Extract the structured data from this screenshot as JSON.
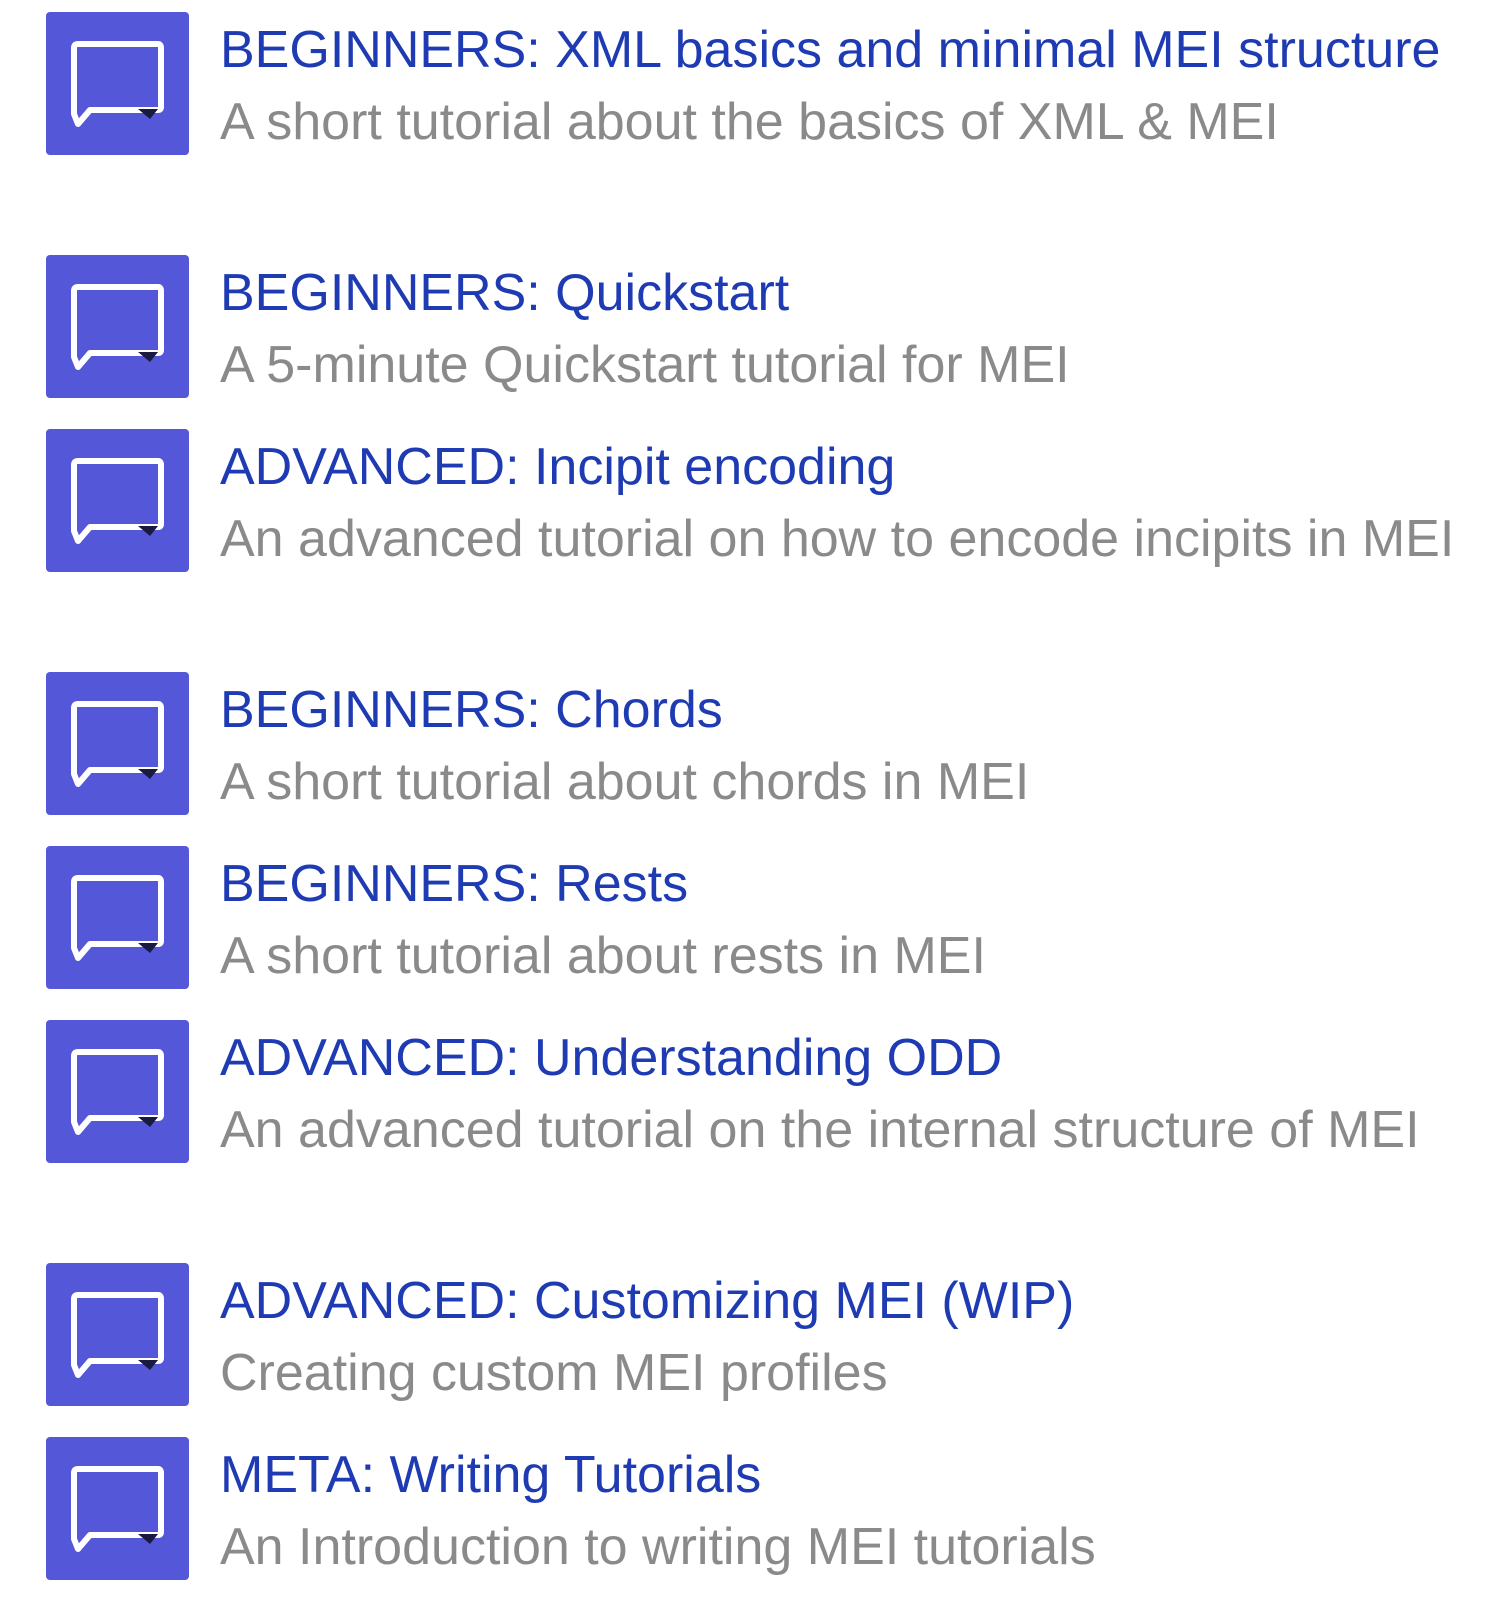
{
  "tutorials": [
    {
      "icon": "speech-bubble-icon",
      "title": "BEGINNERS: XML basics and minimal MEI structure",
      "description": "A short tutorial about the basics of XML & MEI"
    },
    {
      "icon": "speech-bubble-icon",
      "title": "BEGINNERS: Quickstart",
      "description": "A 5-minute Quickstart tutorial for MEI"
    },
    {
      "icon": "speech-bubble-icon",
      "title": "ADVANCED: Incipit encoding",
      "description": "An advanced tutorial on how to encode incipits in MEI"
    },
    {
      "icon": "speech-bubble-icon",
      "title": "BEGINNERS: Chords",
      "description": "A short tutorial about chords in MEI"
    },
    {
      "icon": "speech-bubble-icon",
      "title": "BEGINNERS: Rests",
      "description": "A short tutorial about rests in MEI"
    },
    {
      "icon": "speech-bubble-icon",
      "title": "ADVANCED: Understanding ODD",
      "description": "An advanced tutorial on the internal structure of MEI"
    },
    {
      "icon": "speech-bubble-icon",
      "title": "ADVANCED: Customizing MEI (WIP)",
      "description": "Creating custom MEI profiles"
    },
    {
      "icon": "speech-bubble-icon",
      "title": "META: Writing Tutorials",
      "description": "An Introduction to writing MEI tutorials"
    }
  ],
  "colors": {
    "icon_background": "#5557d9",
    "title_link": "#1f3bb3",
    "description": "#8a8a8a"
  }
}
